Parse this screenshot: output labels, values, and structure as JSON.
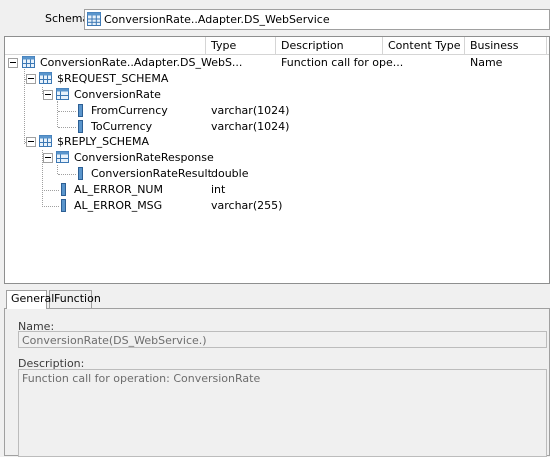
{
  "schema": {
    "label": "Schema:",
    "value": "ConversionRate..Adapter.DS_WebService"
  },
  "columns": [
    "Type",
    "Description",
    "Content Type",
    "Business Name"
  ],
  "tree": [
    {
      "label": "ConversionRate..Adapter.DS_WebS...",
      "type": "",
      "description": "Function call for ope..."
    },
    {
      "label": "$REQUEST_SCHEMA",
      "type": "",
      "description": ""
    },
    {
      "label": "ConversionRate",
      "type": "",
      "description": ""
    },
    {
      "label": "FromCurrency",
      "type": "varchar(1024)",
      "description": ""
    },
    {
      "label": "ToCurrency",
      "type": "varchar(1024)",
      "description": ""
    },
    {
      "label": "$REPLY_SCHEMA",
      "type": "",
      "description": ""
    },
    {
      "label": "ConversionRateResponse",
      "type": "",
      "description": ""
    },
    {
      "label": "ConversionRateResult",
      "type": "double",
      "description": ""
    },
    {
      "label": "AL_ERROR_NUM",
      "type": "int",
      "description": ""
    },
    {
      "label": "AL_ERROR_MSG",
      "type": "varchar(255)",
      "description": ""
    }
  ],
  "tabs": [
    "General",
    "Function"
  ],
  "general": {
    "name_label": "Name:",
    "name_value": "ConversionRate(DS_WebService.)",
    "description_label": "Description:",
    "description_value": "Function call for operation: ConversionRate"
  }
}
